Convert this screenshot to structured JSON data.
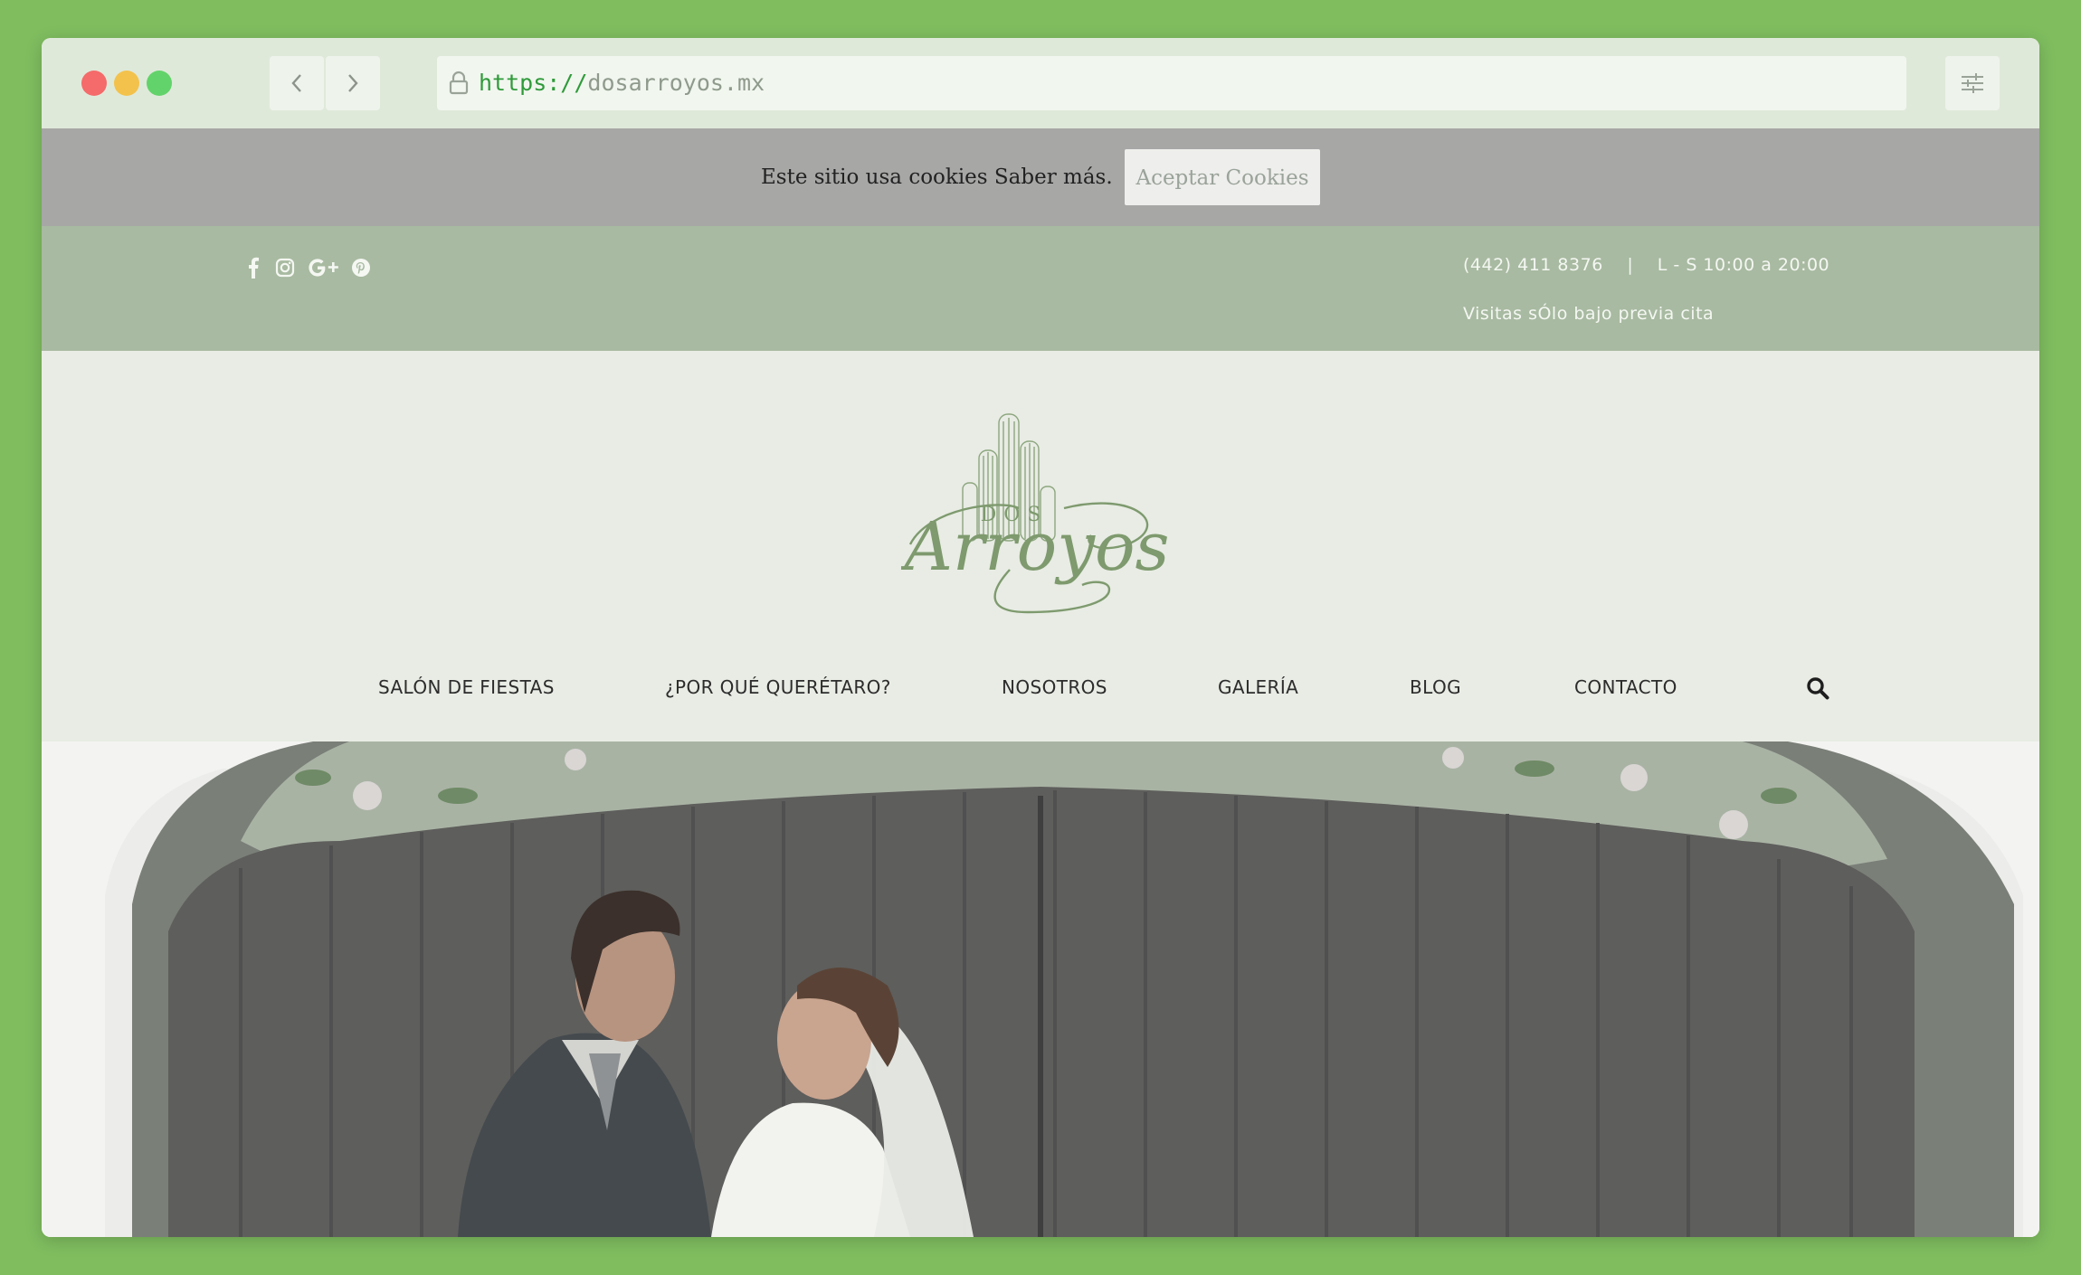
{
  "browser": {
    "url_scheme": "https://",
    "url_host": "dosarroyos.mx"
  },
  "cookie_banner": {
    "text": "Este sitio usa cookies Saber más.",
    "accept_label": "Aceptar Cookies"
  },
  "top_bar": {
    "phone": "(442) 411 8376",
    "separator": "|",
    "hours": "L - S 10:00 a 20:00",
    "note": "Visitas sÓlo bajo previa cita",
    "social_icons": [
      "facebook-icon",
      "instagram-icon",
      "google-plus-icon",
      "pinterest-icon"
    ]
  },
  "logo": {
    "small_text": "DOS",
    "script_text": "Arroyos"
  },
  "nav": {
    "items": [
      {
        "label": "SALÓN DE FIESTAS"
      },
      {
        "label": "¿POR QUÉ QUERÉTARO?"
      },
      {
        "label": "NOSOTROS"
      },
      {
        "label": "GALERÍA"
      },
      {
        "label": "BLOG"
      },
      {
        "label": "CONTACTO"
      }
    ]
  },
  "colors": {
    "page_background": "#7fbd5f",
    "top_bar": "#a8baa1",
    "cookie_banner": "#a7a7a6",
    "logo_green": "#7e9a6e"
  }
}
